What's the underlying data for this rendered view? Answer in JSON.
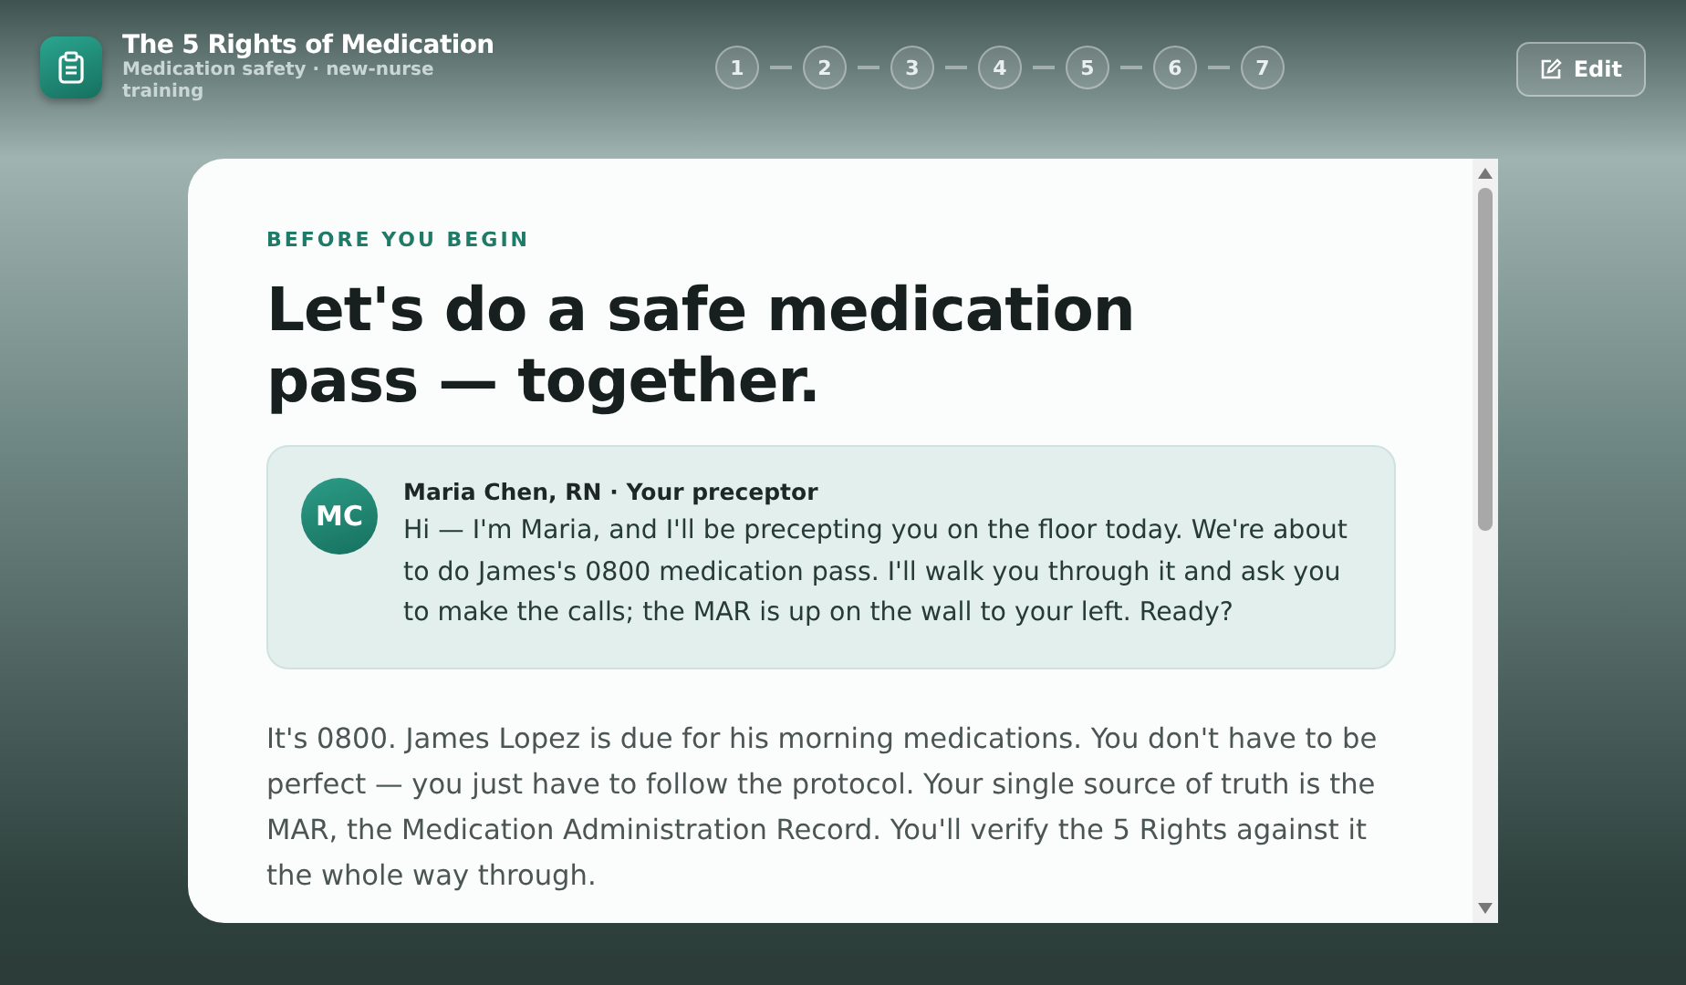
{
  "header": {
    "title": "The 5 Rights of Medication",
    "subtitle": "Medication safety · new-nurse training"
  },
  "steps": [
    "1",
    "2",
    "3",
    "4",
    "5",
    "6",
    "7"
  ],
  "edit_button": "Edit",
  "card": {
    "eyebrow": "BEFORE YOU BEGIN",
    "heading": "Let's do a safe medication pass — together.",
    "message": {
      "initials": "MC",
      "author": "Maria Chen, RN · Your preceptor",
      "text": "Hi — I'm Maria, and I'll be precepting you on the floor today. We're about to do James's 0800 medication pass. I'll walk you through it and ask you to make the calls; the MAR is up on the wall to your left. Ready?"
    },
    "paragraph": "It's 0800. James Lopez is due for his morning medications. You don't have to be perfect — you just have to follow the protocol. Your single source of truth is the MAR, the Medication Administration Record. You'll verify the 5 Rights against it the whole way through."
  }
}
